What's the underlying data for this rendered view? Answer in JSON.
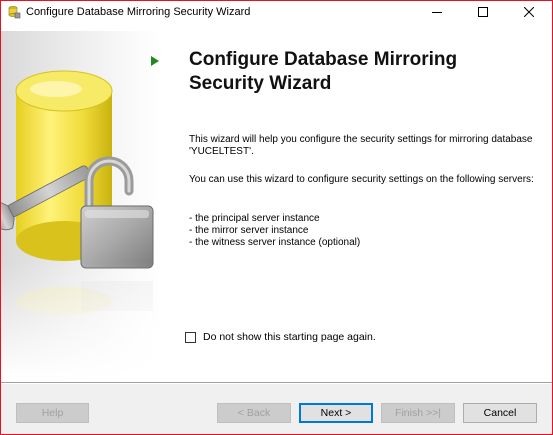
{
  "window": {
    "title": "Configure Database Mirroring Security Wizard",
    "border_color": "#e81123"
  },
  "icons": {
    "app": "wizard-icon",
    "minimize": "minimize-icon",
    "maximize": "maximize-icon",
    "close": "close-icon",
    "illustration": "database-lock-wrench-illustration",
    "step_marker": "green-arrow-icon"
  },
  "content": {
    "heading": "Configure Database Mirroring Security Wizard",
    "intro": "This wizard will help you configure the security settings for mirroring database 'YUCELTEST'.",
    "usage": "You can use this wizard to configure security settings on the following servers:",
    "servers": [
      "- the principal server instance",
      "- the mirror server instance",
      "- the witness server instance (optional)"
    ],
    "checkbox_label": "Do not show this starting page again.",
    "checkbox_checked": false
  },
  "buttons": {
    "help": "Help",
    "back": "< Back",
    "next": "Next >",
    "finish": "Finish >>|",
    "cancel": "Cancel"
  },
  "colors": {
    "arrow": "#1e8a1e",
    "default_button_border": "#0078d7"
  }
}
